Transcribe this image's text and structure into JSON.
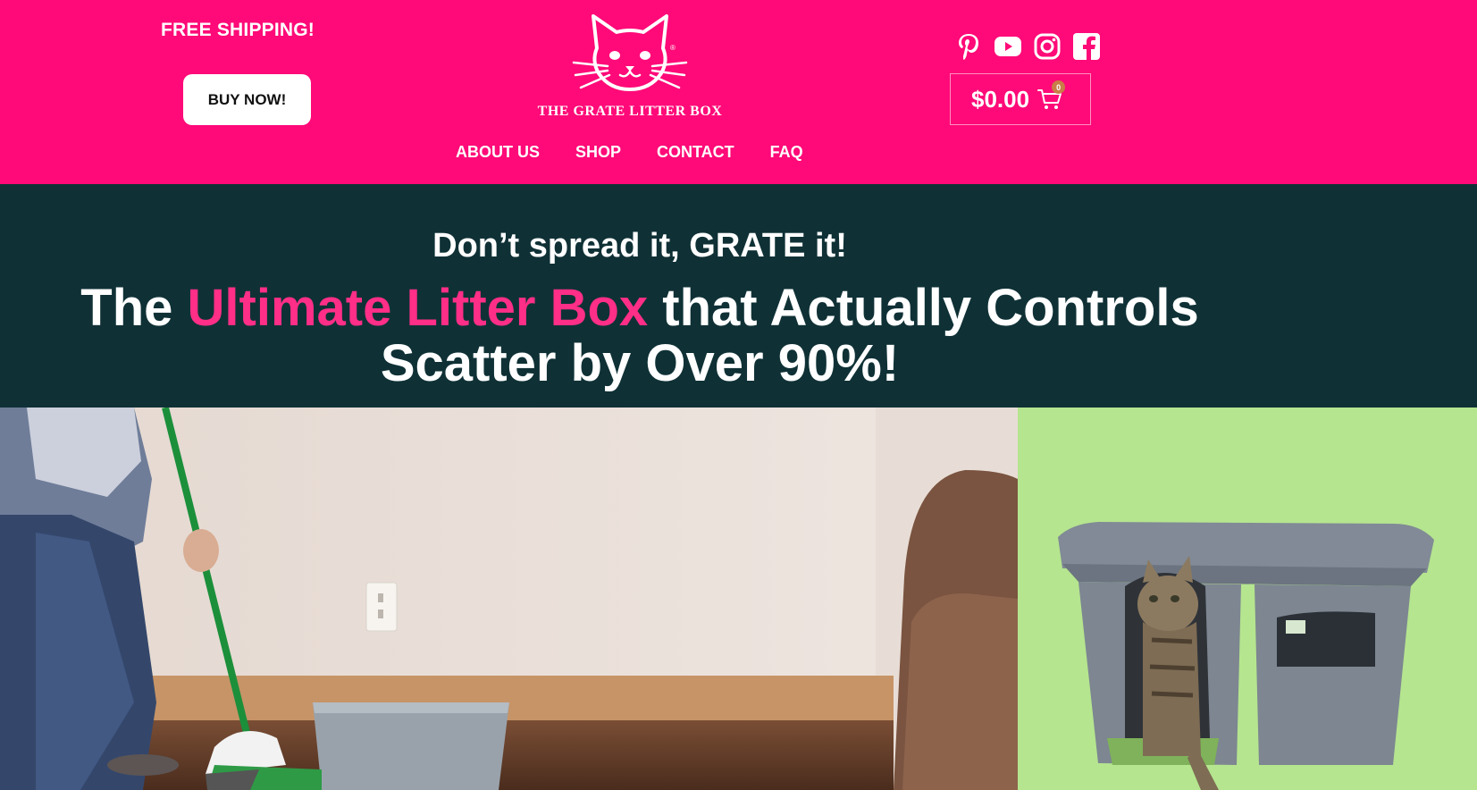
{
  "header": {
    "promo": "FREE SHIPPING!",
    "buy_button": "BUY NOW!",
    "logo_text": "THE GRATE LITTER BOX",
    "logo_mark": "®",
    "nav": [
      "ABOUT US",
      "SHOP",
      "CONTACT",
      "FAQ"
    ],
    "social_icons": [
      "pinterest-icon",
      "youtube-icon",
      "instagram-icon",
      "facebook-icon"
    ],
    "cart": {
      "amount": "$0.00",
      "count": "0"
    },
    "colors": {
      "bar": "#ff0a78",
      "text": "#ffffff"
    }
  },
  "hero": {
    "tagline": "Don’t spread it, GRATE it!",
    "headline_before": "The ",
    "headline_highlight": "Ultimate Litter Box",
    "headline_line1_after": " that Actually Controls",
    "headline_line2": "Scatter by Over 90%!",
    "colors": {
      "background": "#0f3136",
      "highlight": "#ff2e87"
    }
  },
  "media": {
    "left_image": "person sweeping scattered litter beside an open litter box",
    "right_image": "tabby cat stepping out of a grey covered litter box",
    "right_background": "#b5e58f"
  }
}
